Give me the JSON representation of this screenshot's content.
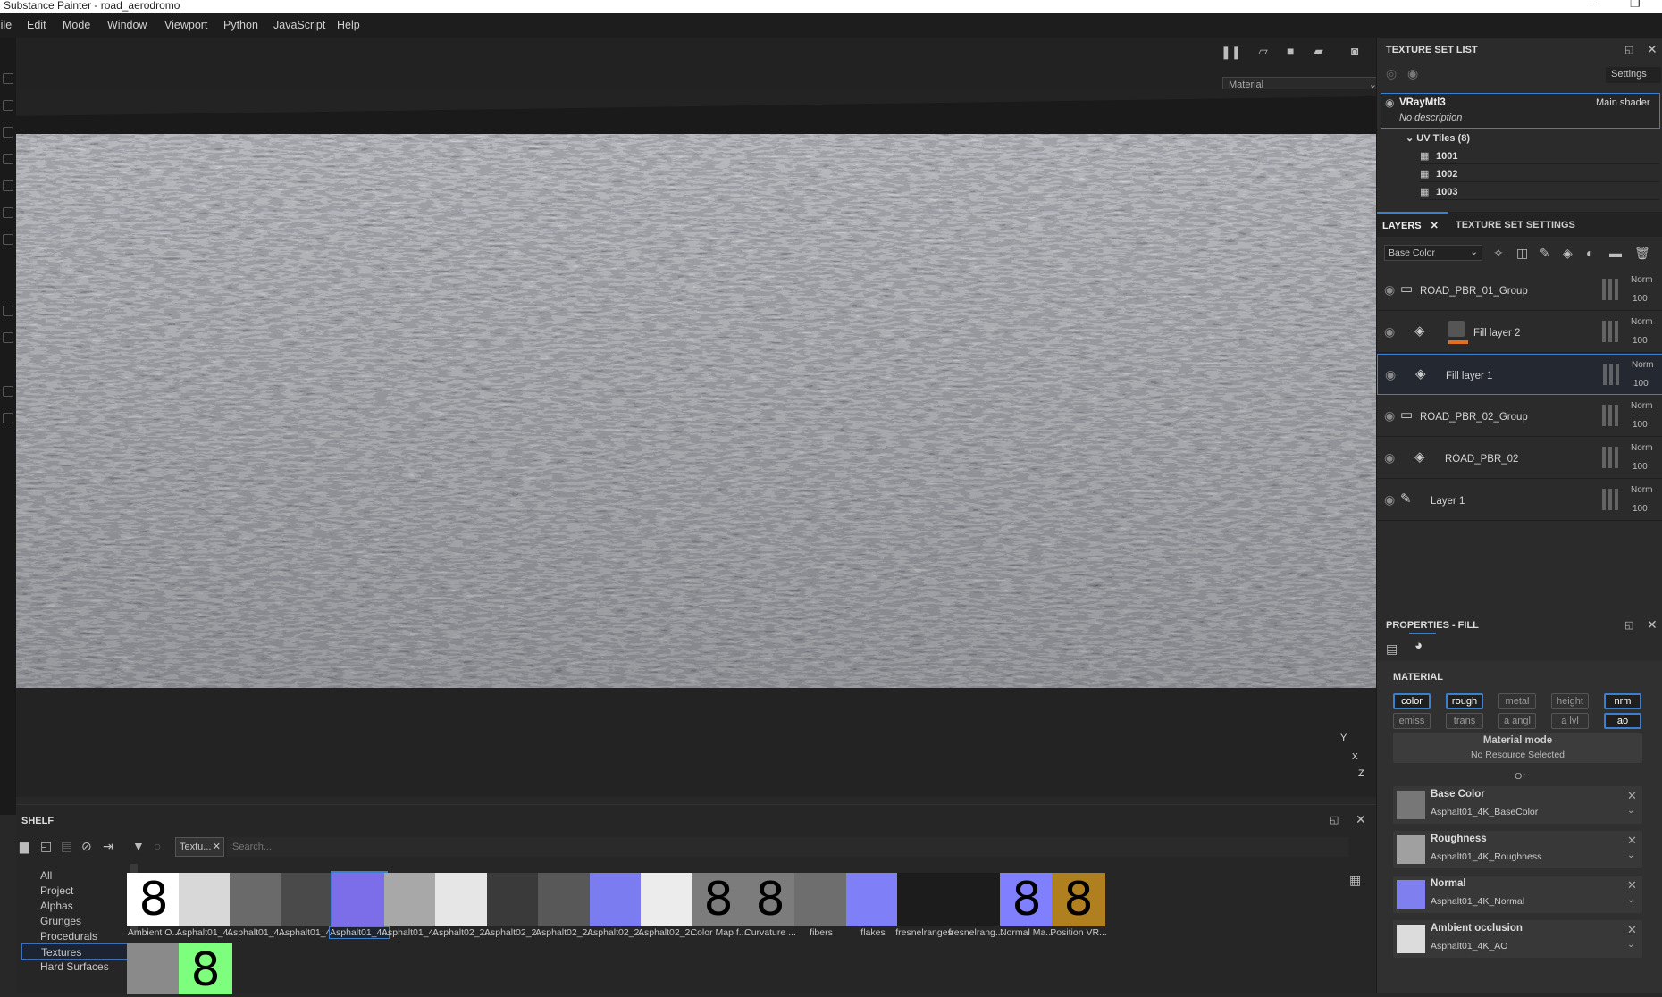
{
  "app": {
    "title": "Substance Painter - road_aerodromo"
  },
  "menu": [
    "File",
    "Edit",
    "Mode",
    "Window",
    "Viewport",
    "Python",
    "JavaScript",
    "Help"
  ],
  "viewport": {
    "display_mode": "Material",
    "axis": {
      "x": "X",
      "y": "Y",
      "z": "Z"
    }
  },
  "texture_set_list": {
    "header": "TEXTURE SET LIST",
    "settings": "Settings",
    "material": {
      "name": "VRayMtl3",
      "shader": "Main shader",
      "description": "No description"
    },
    "uv_tiles_label": "UV Tiles (8)",
    "tiles": [
      "1001",
      "1002",
      "1003"
    ]
  },
  "layers_panel": {
    "tabs": [
      "LAYERS",
      "TEXTURE SET SETTINGS"
    ],
    "channel": "Base Color",
    "layers": [
      {
        "name": "ROAD_PBR_01_Group",
        "blend": "Norm",
        "opacity": "100",
        "kind": "folder"
      },
      {
        "name": "Fill layer 2",
        "blend": "Norm",
        "opacity": "100",
        "kind": "fill-mask"
      },
      {
        "name": "Fill layer 1",
        "blend": "Norm",
        "opacity": "100",
        "kind": "fill",
        "selected": true
      },
      {
        "name": "ROAD_PBR_02_Group",
        "blend": "Norm",
        "opacity": "100",
        "kind": "folder"
      },
      {
        "name": "ROAD_PBR_02",
        "blend": "Norm",
        "opacity": "100",
        "kind": "fill"
      },
      {
        "name": "Layer 1",
        "blend": "Norm",
        "opacity": "100",
        "kind": "paint"
      }
    ]
  },
  "properties": {
    "header": "PROPERTIES - FILL",
    "material_label": "MATERIAL",
    "channels_row1": [
      {
        "label": "color",
        "on": true
      },
      {
        "label": "rough",
        "on": true
      },
      {
        "label": "metal",
        "on": false
      },
      {
        "label": "height",
        "on": false
      },
      {
        "label": "nrm",
        "on": true
      }
    ],
    "channels_row2": [
      {
        "label": "emiss",
        "on": false
      },
      {
        "label": "trans",
        "on": false
      },
      {
        "label": "a angl",
        "on": false
      },
      {
        "label": "a lvl",
        "on": false
      },
      {
        "label": "ao",
        "on": true
      }
    ],
    "material_mode": "Material mode",
    "no_resource": "No Resource Selected",
    "or": "Or",
    "slots": [
      {
        "name": "Base Color",
        "value": "Asphalt01_4K_BaseColor",
        "swatch": "#777777"
      },
      {
        "name": "Roughness",
        "value": "Asphalt01_4K_Roughness",
        "swatch": "#a0a0a0"
      },
      {
        "name": "Normal",
        "value": "Asphalt01_4K_Normal",
        "swatch": "#7f7ff0"
      },
      {
        "name": "Ambient occlusion",
        "value": "Asphalt01_4K_AO",
        "swatch": "#dcdcdc"
      }
    ]
  },
  "shelf": {
    "header": "SHELF",
    "filter_tag": "Textu...",
    "search_placeholder": "Search...",
    "categories": [
      "All",
      "Project",
      "Alphas",
      "Grunges",
      "Procedurals",
      "Textures",
      "Hard Surfaces"
    ],
    "selected_category": "Textures",
    "items": [
      {
        "label": "Ambient O...",
        "color": "#ffffff",
        "glyph": "8"
      },
      {
        "label": "Asphalt01_4...",
        "color": "#d8d8d8",
        "glyph": ""
      },
      {
        "label": "Asphalt01_4...",
        "color": "#6a6a6a",
        "glyph": ""
      },
      {
        "label": "Asphalt01_4...",
        "color": "#4a4a4a",
        "glyph": ""
      },
      {
        "label": "Asphalt01_4...",
        "color": "#7b6ee8",
        "glyph": "",
        "selected": true
      },
      {
        "label": "Asphalt01_4...",
        "color": "#a8a8a8",
        "glyph": ""
      },
      {
        "label": "Asphalt02_2...",
        "color": "#e6e6e6",
        "glyph": ""
      },
      {
        "label": "Asphalt02_2...",
        "color": "#3a3a3a",
        "glyph": ""
      },
      {
        "label": "Asphalt02_2...",
        "color": "#585858",
        "glyph": ""
      },
      {
        "label": "Asphalt02_2...",
        "color": "#7a7cf0",
        "glyph": ""
      },
      {
        "label": "Asphalt02_2...",
        "color": "#ececec",
        "glyph": ""
      },
      {
        "label": "Color Map f...",
        "color": "#7c7c7c",
        "glyph": "8"
      },
      {
        "label": "Curvature ...",
        "color": "#7c7c7c",
        "glyph": "8"
      },
      {
        "label": "fibers",
        "color": "#6e6e6e",
        "glyph": ""
      },
      {
        "label": "flakes",
        "color": "#7f7ff8",
        "glyph": ""
      },
      {
        "label": "fresnelranges",
        "color": "#1c1c1c",
        "glyph": ""
      },
      {
        "label": "fresnelrang...",
        "color": "#1c1c1c",
        "glyph": ""
      },
      {
        "label": "Normal Ma...",
        "color": "#8080ff",
        "glyph": "8"
      },
      {
        "label": "Position VR...",
        "color": "#b08020",
        "glyph": "8"
      }
    ],
    "row2": [
      {
        "color": "#8a8a8a",
        "glyph": ""
      },
      {
        "color": "#7dff7d",
        "glyph": "8"
      }
    ]
  }
}
